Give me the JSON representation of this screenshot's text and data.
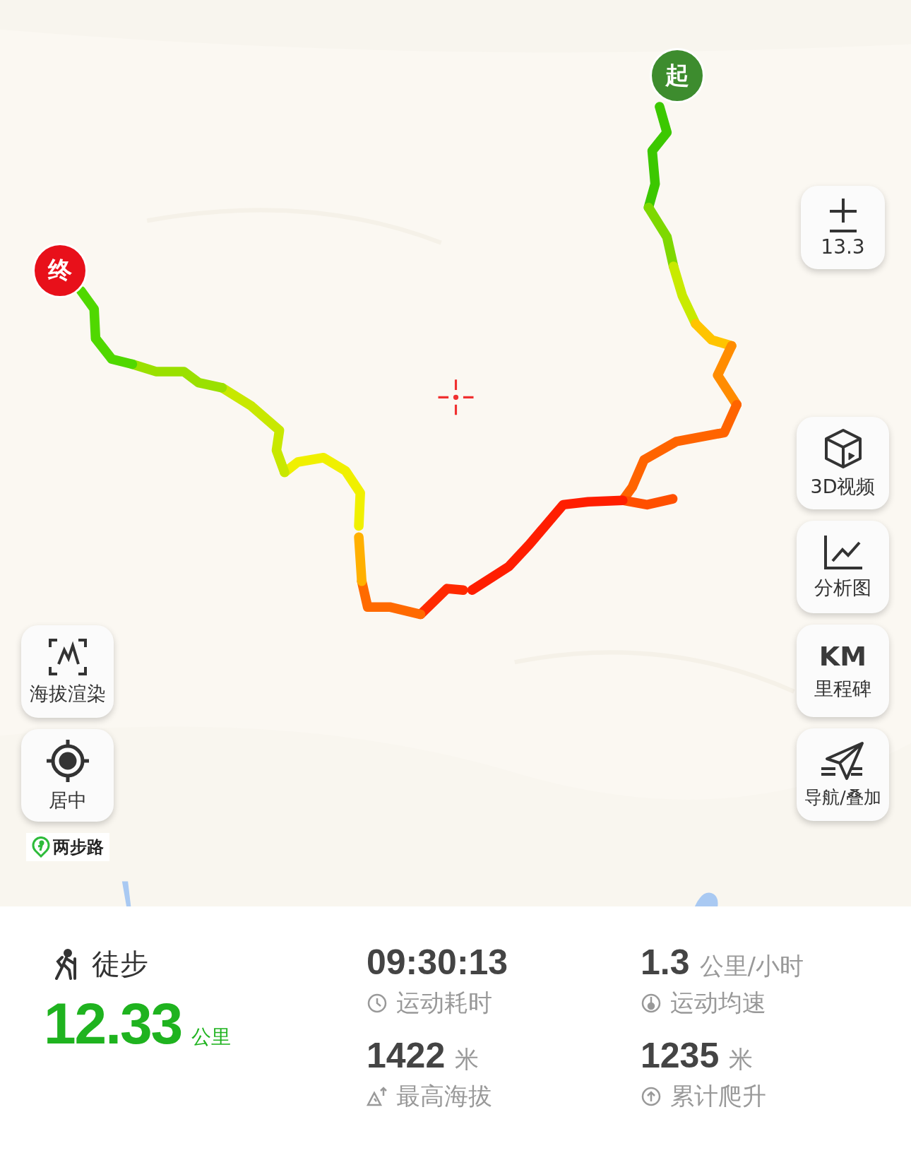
{
  "map": {
    "kind": "picture",
    "start_marker": "起",
    "end_marker": "终"
  },
  "zoom_control": {
    "level": "13.3"
  },
  "left_buttons": [
    {
      "kind": "elevation",
      "label": "海拔渲染"
    },
    {
      "kind": "center",
      "label": "居中"
    }
  ],
  "logo": "两步路",
  "right_buttons": [
    {
      "kind": "cube",
      "label": "3D视频"
    },
    {
      "kind": "chart",
      "label": "分析图"
    },
    {
      "kind": "km",
      "badge": "KM",
      "label": "里程碑"
    },
    {
      "kind": "nav",
      "label": "导航/叠加"
    }
  ],
  "summary": {
    "activity": "徒步",
    "distance": "12.33",
    "distance_unit": "公里",
    "stats": [
      {
        "kind": "clock",
        "value": "09:30:13",
        "label": "运动耗时"
      },
      {
        "kind": "speed",
        "value": "1.3",
        "unit": "公里/小时",
        "label": "运动均速"
      },
      {
        "kind": "peak",
        "value": "1422",
        "unit": "米",
        "label": "最高海拔"
      },
      {
        "kind": "climb",
        "value": "1235",
        "unit": "米",
        "label": "累计爬升"
      }
    ]
  }
}
